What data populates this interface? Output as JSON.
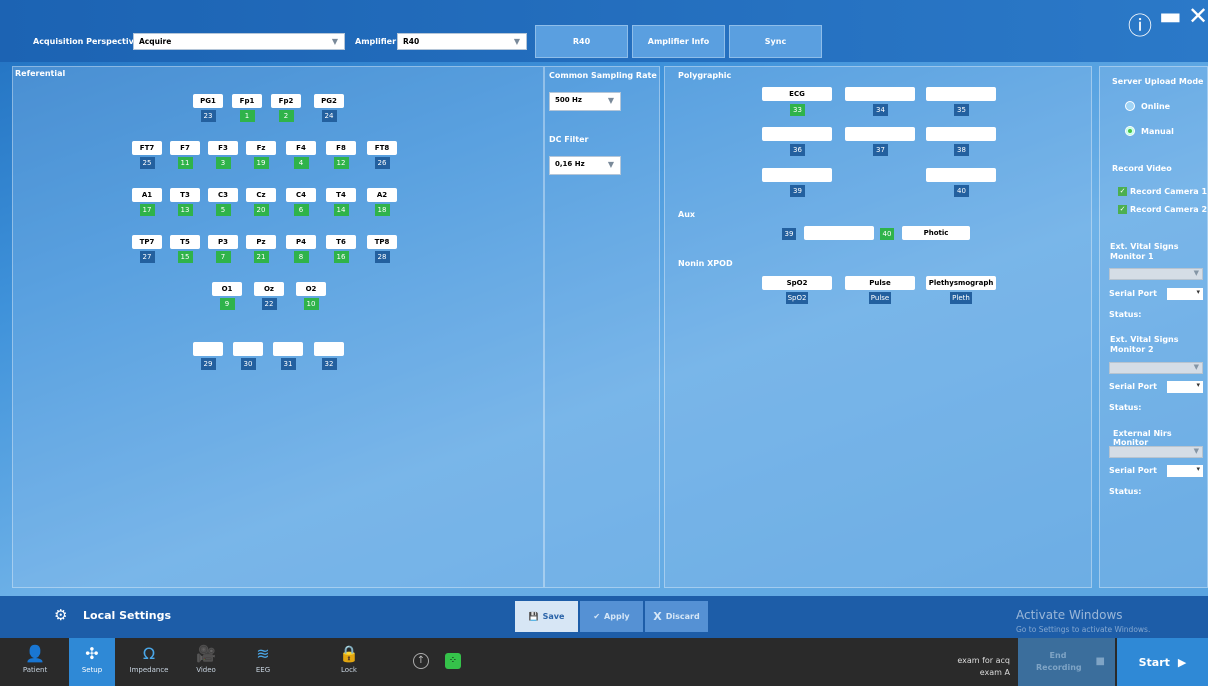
{
  "top": {
    "perspective_label": "Acquisition Perspective",
    "perspective_value": "Acquire",
    "amplifier_label": "Amplifier",
    "amplifier_value": "R40",
    "tabs": [
      "R40",
      "Amplifier Info",
      "Sync"
    ]
  },
  "referential": {
    "title": "Referential",
    "electrodes": [
      {
        "name": "PG1",
        "ch": "23",
        "active": false
      },
      {
        "name": "Fp1",
        "ch": "1",
        "active": true
      },
      {
        "name": "Fp2",
        "ch": "2",
        "active": true
      },
      {
        "name": "PG2",
        "ch": "24",
        "active": false
      },
      {
        "name": "FT7",
        "ch": "25",
        "active": false
      },
      {
        "name": "F7",
        "ch": "11",
        "active": true
      },
      {
        "name": "F3",
        "ch": "3",
        "active": true
      },
      {
        "name": "Fz",
        "ch": "19",
        "active": true
      },
      {
        "name": "F4",
        "ch": "4",
        "active": true
      },
      {
        "name": "F8",
        "ch": "12",
        "active": true
      },
      {
        "name": "FT8",
        "ch": "26",
        "active": false
      },
      {
        "name": "A1",
        "ch": "17",
        "active": true
      },
      {
        "name": "T3",
        "ch": "13",
        "active": true
      },
      {
        "name": "C3",
        "ch": "5",
        "active": true
      },
      {
        "name": "Cz",
        "ch": "20",
        "active": true
      },
      {
        "name": "C4",
        "ch": "6",
        "active": true
      },
      {
        "name": "T4",
        "ch": "14",
        "active": true
      },
      {
        "name": "A2",
        "ch": "18",
        "active": true
      },
      {
        "name": "TP7",
        "ch": "27",
        "active": false
      },
      {
        "name": "T5",
        "ch": "15",
        "active": true
      },
      {
        "name": "P3",
        "ch": "7",
        "active": true
      },
      {
        "name": "Pz",
        "ch": "21",
        "active": true
      },
      {
        "name": "P4",
        "ch": "8",
        "active": true
      },
      {
        "name": "T6",
        "ch": "16",
        "active": true
      },
      {
        "name": "TP8",
        "ch": "28",
        "active": false
      },
      {
        "name": "O1",
        "ch": "9",
        "active": true
      },
      {
        "name": "Oz",
        "ch": "22",
        "active": false
      },
      {
        "name": "O2",
        "ch": "10",
        "active": true
      },
      {
        "name": "",
        "ch": "29",
        "active": false
      },
      {
        "name": "",
        "ch": "30",
        "active": false
      },
      {
        "name": "",
        "ch": "31",
        "active": false
      },
      {
        "name": "",
        "ch": "32",
        "active": false
      }
    ]
  },
  "sampling": {
    "title": "Common Sampling Rate",
    "value": "500 Hz",
    "dc_title": "DC Filter",
    "dc_value": "0,16 Hz"
  },
  "polygraphic": {
    "title": "Polygraphic",
    "boxes": [
      {
        "name": "ECG",
        "ch": "33",
        "active": true
      },
      {
        "name": "",
        "ch": "34",
        "active": false
      },
      {
        "name": "",
        "ch": "35",
        "active": false
      },
      {
        "name": "",
        "ch": "36",
        "active": false
      },
      {
        "name": "",
        "ch": "37",
        "active": false
      },
      {
        "name": "",
        "ch": "38",
        "active": false
      },
      {
        "name": "",
        "ch": "39",
        "active": false
      },
      {
        "name": "",
        "ch": "40",
        "active": false
      }
    ],
    "aux_title": "Aux",
    "aux": [
      {
        "ch": "39",
        "name": "",
        "active": false
      },
      {
        "ch": "40",
        "name": "Photic",
        "active": true
      }
    ],
    "nonin_title": "Nonin XPOD",
    "nonin": [
      {
        "name": "SpO2",
        "ch": "SpO2"
      },
      {
        "name": "Pulse",
        "ch": "Pulse"
      },
      {
        "name": "Plethysmograph",
        "ch": "Pleth"
      }
    ]
  },
  "right": {
    "upload_title": "Server Upload Mode",
    "online": "Online",
    "manual": "Manual",
    "video_title": "Record Video",
    "cam1": "Record Camera 1",
    "cam2": "Record Camera 2",
    "monitor1": "Ext. Vital Signs Monitor 1",
    "monitor2": "Ext. Vital Signs Monitor 2",
    "nirs": "External Nirs Monitor",
    "serial": "Serial Port",
    "status": "Status:"
  },
  "bottom": {
    "local_settings": "Local Settings",
    "save": "Save",
    "apply": "Apply",
    "discard": "Discard",
    "watermark1": "Activate Windows",
    "watermark2": "Go to Settings to activate Windows.",
    "nav": [
      "Patient",
      "Setup",
      "Impedance",
      "Video",
      "EEG",
      "Lock"
    ],
    "exam1": "exam for acq",
    "exam2": "exam A",
    "end": "End Recording",
    "start": "Start"
  }
}
